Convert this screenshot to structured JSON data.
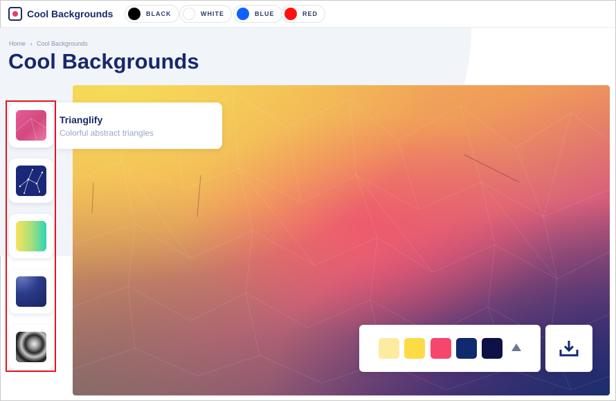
{
  "app": {
    "name": "Cool Backgrounds"
  },
  "color_filters": [
    {
      "label": "BLACK",
      "color": "#000000"
    },
    {
      "label": "WHITE",
      "color": "#ffffff"
    },
    {
      "label": "BLUE",
      "color": "#1060ff"
    },
    {
      "label": "RED",
      "color": "#ff1010"
    }
  ],
  "breadcrumb": {
    "home": "Home",
    "separator": "›",
    "current": "Cool Backgrounds"
  },
  "page": {
    "title": "Cool Backgrounds"
  },
  "generators": [
    {
      "name": "Trianglify",
      "description": "Colorful abstract triangles",
      "icon": "trianglify-thumbnail"
    },
    {
      "name": "",
      "icon": "constellation-thumbnail"
    },
    {
      "name": "",
      "icon": "gradient-thumbnail"
    },
    {
      "name": "",
      "icon": "waves-thumbnail"
    },
    {
      "name": "",
      "icon": "swirl-thumbnail"
    }
  ],
  "tooltip": {
    "title": "Trianglify",
    "description": "Colorful abstract triangles"
  },
  "palette": {
    "swatches": [
      "#fdeba0",
      "#fbdc46",
      "#f7466e",
      "#0f2a6e",
      "#0d1145"
    ],
    "expand_icon": "caret-up-icon"
  },
  "download": {
    "icon": "download-icon"
  },
  "colors": {
    "brand": "#17296b",
    "accent": "#e83a6b",
    "highlight_border": "#e5141f"
  }
}
